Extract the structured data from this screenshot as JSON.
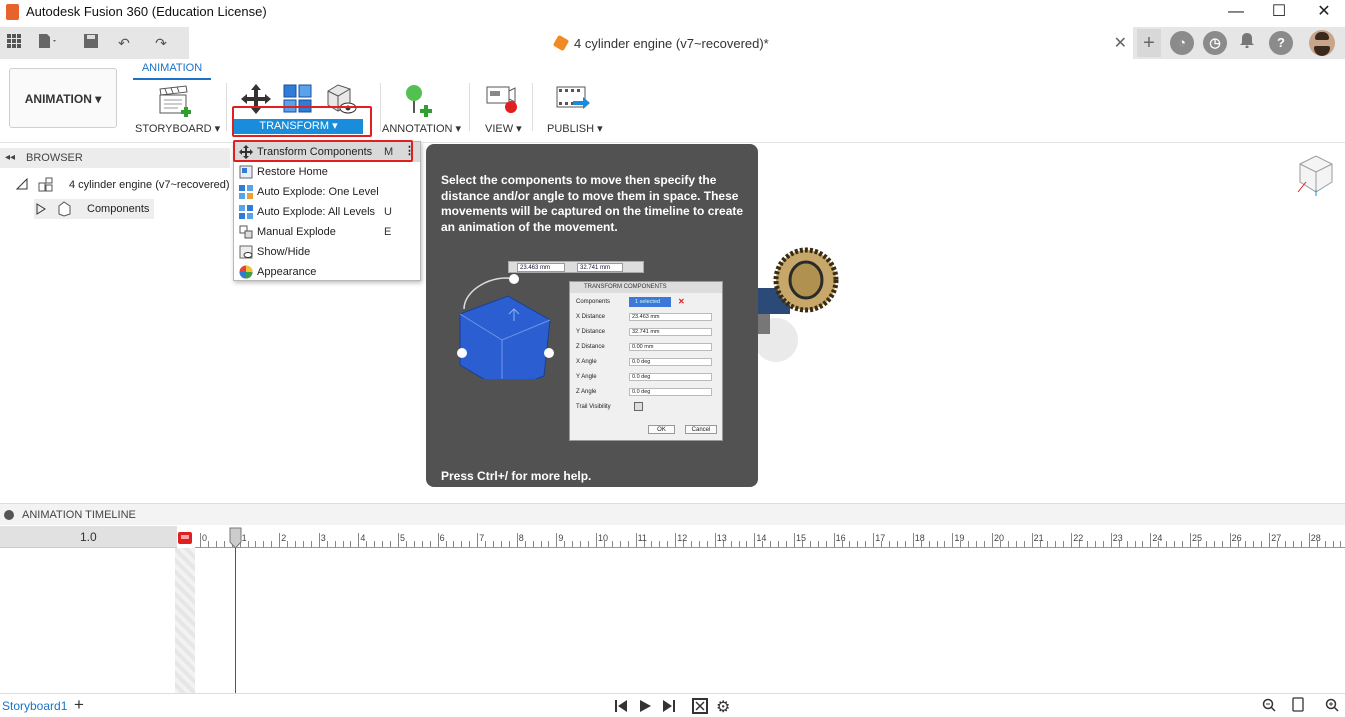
{
  "window": {
    "title": "Autodesk Fusion 360 (Education License)",
    "minimize": "—",
    "maximize": "☐",
    "close": "✕"
  },
  "doc_tab": {
    "title": "4 cylinder engine (v7~recovered)*",
    "close": "✕"
  },
  "toolbar": {
    "workspace_label": "ANIMATION",
    "active_tab": "ANIMATION",
    "groups": {
      "storyboard": "STORYBOARD ▾",
      "transform": "TRANSFORM ▾",
      "annotation": "ANNOTATION ▾",
      "view": "VIEW ▾",
      "publish": "PUBLISH ▾"
    }
  },
  "browser": {
    "header": "BROWSER",
    "root": "4 cylinder engine (v7~recovered)",
    "child": "Components"
  },
  "transform_menu": {
    "items": [
      {
        "label": "Transform Components",
        "shortcut": "M",
        "icon": "move-arrows-icon"
      },
      {
        "label": "Restore Home",
        "shortcut": "",
        "icon": "restore-home-icon"
      },
      {
        "label": "Auto Explode: One Level",
        "shortcut": "",
        "icon": "explode-one-icon"
      },
      {
        "label": "Auto Explode: All Levels",
        "shortcut": "U",
        "icon": "explode-all-icon"
      },
      {
        "label": "Manual Explode",
        "shortcut": "E",
        "icon": "manual-explode-icon"
      },
      {
        "label": "Show/Hide",
        "shortcut": "",
        "icon": "show-hide-icon"
      },
      {
        "label": "Appearance",
        "shortcut": "",
        "icon": "appearance-icon"
      }
    ]
  },
  "tooltip": {
    "description": "Select the components to move then specify the distance and/or angle to move them in space. These movements will be captured on the timeline to create an animation of the movement.",
    "help": "Press Ctrl+/ for more help.",
    "field_x": "23.463 mm",
    "field_y": "32.741 mm",
    "dialog": {
      "title": "TRANSFORM COMPONENTS",
      "rows": [
        {
          "label": "Components",
          "value": "1 selected"
        },
        {
          "label": "X Distance",
          "value": "23.463 mm"
        },
        {
          "label": "Y Distance",
          "value": "32.741 mm"
        },
        {
          "label": "Z Distance",
          "value": "0.00 mm"
        },
        {
          "label": "X Angle",
          "value": "0.0 deg"
        },
        {
          "label": "Y Angle",
          "value": "0.0 deg"
        },
        {
          "label": "Z Angle",
          "value": "0.0 deg"
        },
        {
          "label": "Trail Visibility",
          "value": ""
        }
      ],
      "ok": "OK",
      "cancel": "Cancel"
    }
  },
  "timeline": {
    "header": "ANIMATION TIMELINE",
    "speed": "1.0",
    "ticks": [
      "0",
      "1",
      "2",
      "3",
      "4",
      "5",
      "6",
      "7",
      "8",
      "9",
      "10",
      "11",
      "12",
      "13",
      "14",
      "15",
      "16",
      "17",
      "18",
      "19",
      "20",
      "21",
      "22",
      "23",
      "24",
      "25",
      "26",
      "27",
      "28"
    ]
  },
  "footer": {
    "storyboard": "Storyboard1",
    "add": "+"
  },
  "colors": {
    "accent": "#1a8cdc",
    "highlight": "#e02020",
    "tooltip_bg": "#525252"
  }
}
